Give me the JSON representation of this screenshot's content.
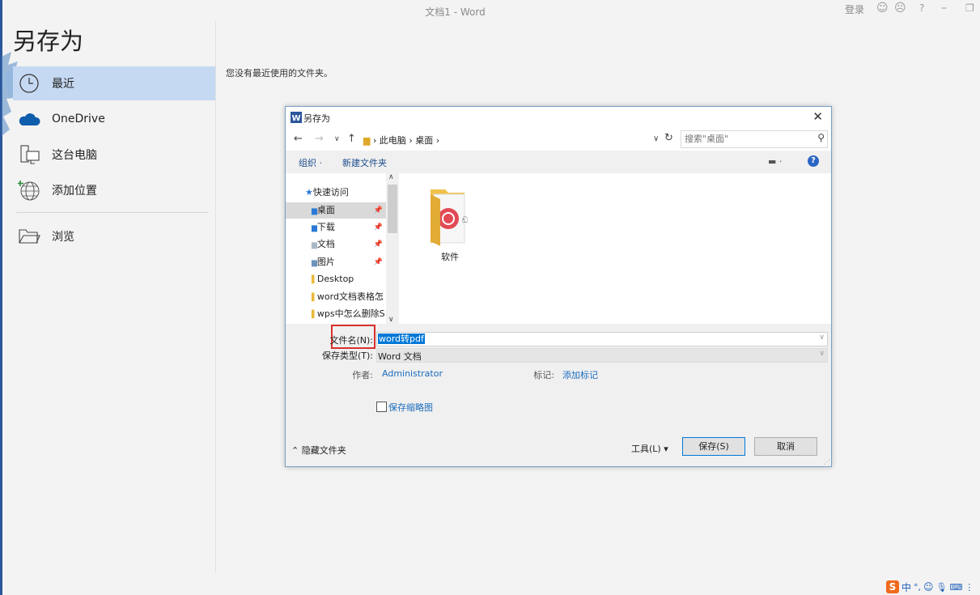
{
  "window": {
    "title": "文档1  -  Word",
    "login_label": "登录",
    "help_glyph": "?"
  },
  "page": {
    "title": "另存为",
    "empty_message": "您没有最近使用的文件夹。"
  },
  "nav": {
    "items": [
      {
        "label": "最近",
        "icon": "clock-icon"
      },
      {
        "label": "OneDrive",
        "icon": "cloud-icon"
      },
      {
        "label": "这台电脑",
        "icon": "computer-icon"
      },
      {
        "label": "添加位置",
        "icon": "globe-add-icon"
      },
      {
        "label": "浏览",
        "icon": "folder-open-icon"
      }
    ]
  },
  "dialog": {
    "title": "另存为",
    "close_glyph": "✕",
    "breadcrumb": {
      "root": "此电脑",
      "current": "桌面"
    },
    "search_placeholder": "搜索\"桌面\"",
    "toolbar": {
      "organize": "组织 ·",
      "new_folder": "新建文件夹",
      "help": "?"
    },
    "tree": [
      {
        "label": "快速访问",
        "pinned": false
      },
      {
        "label": "桌面",
        "pinned": true
      },
      {
        "label": "下载",
        "pinned": true
      },
      {
        "label": "文档",
        "pinned": true
      },
      {
        "label": "图片",
        "pinned": true
      },
      {
        "label": "Desktop",
        "pinned": false
      },
      {
        "label": "word文档表格怎",
        "pinned": false
      },
      {
        "label": "wps中怎么删除S",
        "pinned": false
      }
    ],
    "files": [
      {
        "name": "软件"
      }
    ],
    "filename_label": "文件名(N):",
    "filename_value": "word转pdf",
    "filetype_label": "保存类型(T):",
    "filetype_value": "Word 文档",
    "author_label": "作者:",
    "author_value": "Administrator",
    "tags_label": "标记:",
    "tags_value": "添加标记",
    "thumbnail_label": "保存缩略图",
    "hide_folders_label": "隐藏文件夹",
    "tools_label": "工具(L)",
    "save_label": "保存(S)",
    "cancel_label": "取消"
  },
  "taskbar": {
    "ime_glyph": "S",
    "ime_lang": "中"
  },
  "colors": {
    "accent": "#2b579a",
    "nav_active": "#c5d9f3",
    "selection": "#0078d7",
    "highlight_box": "#d9302c",
    "link": "#1a6bbd"
  }
}
